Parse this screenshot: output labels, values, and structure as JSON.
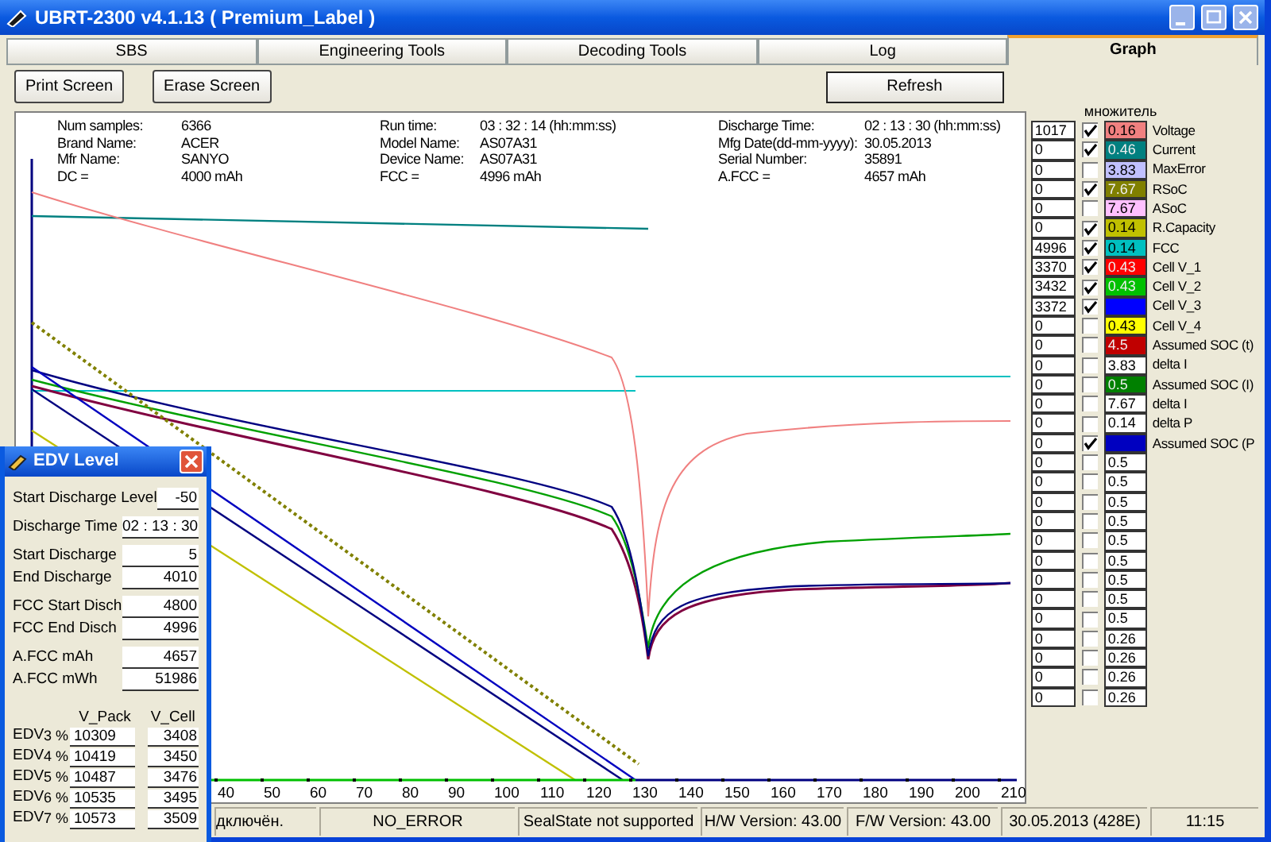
{
  "window": {
    "title": "UBRT-2300 v4.1.13  ( Premium_Label )"
  },
  "tabs": [
    {
      "label": "SBS",
      "selected": false
    },
    {
      "label": "Engineering Tools",
      "selected": false
    },
    {
      "label": "Decoding Tools",
      "selected": false
    },
    {
      "label": "Log",
      "selected": false
    },
    {
      "label": "Graph",
      "selected": true
    }
  ],
  "toolbar": {
    "buttons": [
      {
        "label": "Print Screen"
      },
      {
        "label": "Erase Screen"
      }
    ],
    "refresh_button": {
      "label": "Refresh"
    }
  },
  "info_columns": [
    [
      {
        "label": "Num samples:",
        "value": "6366"
      },
      {
        "label": "Brand Name:",
        "value": "ACER"
      },
      {
        "label": "Mfr Name:",
        "value": "SANYO"
      },
      {
        "label": "DC =",
        "value": "4000 mAh"
      }
    ],
    [
      {
        "label": "Run time:",
        "value": "03 : 32 : 14 (hh:mm:ss)"
      },
      {
        "label": "Model Name:",
        "value": "AS07A31"
      },
      {
        "label": "Device Name:",
        "value": "AS07A31"
      },
      {
        "label": "FCC =",
        "value": "4996 mAh"
      }
    ],
    [
      {
        "label": "Discharge Time:",
        "value": "02 : 13 : 30 (hh:mm:ss)"
      },
      {
        "label": "Mfg Date(dd-mm-yyyy):",
        "value": "30.05.2013"
      },
      {
        "label": "Serial Number:",
        "value": "35891"
      },
      {
        "label": "A.FCC =",
        "value": "4657 mAh"
      }
    ]
  ],
  "chart": {
    "x_axis_labels": [
      "40",
      "50",
      "60",
      "70",
      "80",
      "90",
      "100",
      "110",
      "120",
      "130",
      "140",
      "150",
      "160",
      "170",
      "180",
      "190",
      "200",
      "210"
    ]
  },
  "channel_panel": {
    "header": "множитель",
    "channels": [
      {
        "value": "1017",
        "checked": true,
        "multiplier": "0.16",
        "color": "#f08080",
        "label": "Voltage"
      },
      {
        "value": "0",
        "checked": true,
        "multiplier": "0.46",
        "color": "#008080",
        "label": "Current"
      },
      {
        "value": "0",
        "checked": false,
        "multiplier": "3.83",
        "color": "#c0c0ff",
        "label": "MaxError"
      },
      {
        "value": "0",
        "checked": true,
        "multiplier": "7.67",
        "color": "#808000",
        "label": "RSoC"
      },
      {
        "value": "0",
        "checked": false,
        "multiplier": "7.67",
        "color": "#ffc0ff",
        "label": "ASoC"
      },
      {
        "value": "0",
        "checked": true,
        "multiplier": "0.14",
        "color": "#c0c000",
        "label": "R.Capacity"
      },
      {
        "value": "4996",
        "checked": true,
        "multiplier": "0.14",
        "color": "#00c0c0",
        "label": "FCC"
      },
      {
        "value": "3370",
        "checked": true,
        "multiplier": "0.43",
        "color": "#ff0000",
        "label": "Cell V_1"
      },
      {
        "value": "3432",
        "checked": true,
        "multiplier": "0.43",
        "color": "#00c000",
        "label": "Cell V_2"
      },
      {
        "value": "3372",
        "checked": true,
        "color": "#0000ff",
        "label": "Cell V_3"
      },
      {
        "value": "0",
        "checked": false,
        "multiplier": "0.43",
        "color": "#ffff00",
        "label": "Cell V_4"
      },
      {
        "value": "0",
        "checked": false,
        "multiplier": "4.5",
        "color": "#c00000",
        "label": "Assumed SOC (t)"
      },
      {
        "value": "0",
        "checked": false,
        "multiplier": "3.83",
        "color": "#ffffff",
        "label": "delta I"
      },
      {
        "value": "0",
        "checked": false,
        "multiplier": "0.5",
        "color": "#008000",
        "label": "Assumed SOC (I)"
      },
      {
        "value": "0",
        "checked": false,
        "multiplier": "7.67",
        "color": "#ffffff",
        "label": "delta I"
      },
      {
        "value": "0",
        "checked": false,
        "multiplier": "0.14",
        "color": "#ffffff",
        "label": "delta P"
      },
      {
        "value": "0",
        "checked": true,
        "color": "#0000c0",
        "label": "Assumed SOC (P"
      },
      {
        "value": "0",
        "checked": false,
        "multiplier": "0.5",
        "color": "#ffffff"
      },
      {
        "value": "0",
        "checked": false,
        "multiplier": "0.5",
        "color": "#ffffff"
      },
      {
        "value": "0",
        "checked": false,
        "multiplier": "0.5",
        "color": "#ffffff"
      },
      {
        "value": "0",
        "checked": false,
        "multiplier": "0.5",
        "color": "#ffffff"
      },
      {
        "value": "0",
        "checked": false,
        "multiplier": "0.5",
        "color": "#ffffff"
      },
      {
        "value": "0",
        "checked": false,
        "multiplier": "0.5",
        "color": "#ffffff"
      },
      {
        "value": "0",
        "checked": false,
        "multiplier": "0.5",
        "color": "#ffffff"
      },
      {
        "value": "0",
        "checked": false,
        "multiplier": "0.5",
        "color": "#ffffff"
      },
      {
        "value": "0",
        "checked": false,
        "multiplier": "0.5",
        "color": "#ffffff"
      },
      {
        "value": "0",
        "checked": false,
        "multiplier": "0.26",
        "color": "#ffffff"
      },
      {
        "value": "0",
        "checked": false,
        "multiplier": "0.26",
        "color": "#ffffff"
      },
      {
        "value": "0",
        "checked": false,
        "multiplier": "0.26",
        "color": "#ffffff"
      },
      {
        "value": "0",
        "checked": false,
        "multiplier": "0.26",
        "color": "#ffffff"
      }
    ]
  },
  "status_bar": [
    "дключён.",
    "NO_ERROR",
    "SealState not supported",
    "H/W Version: 43.00",
    "F/W Version: 43.00",
    "30.05.2013  (428E)",
    "11:15"
  ],
  "edv_dialog": {
    "title": "EDV Level",
    "field_groups": [
      [
        {
          "label": "Start Discharge Level",
          "value": "-50"
        }
      ],
      [
        {
          "label": "Discharge Time",
          "value": "02 : 13 : 30"
        }
      ],
      [
        {
          "label": "Start Discharge",
          "value": "5"
        },
        {
          "label": "End  Discharge",
          "value": "4010"
        }
      ],
      [
        {
          "label": "FCC Start Disch",
          "value": "4800"
        },
        {
          "label": "FCC End  Disch",
          "value": "4996"
        }
      ],
      [
        {
          "label": "A.FCC mAh",
          "value": "4657"
        },
        {
          "label": "A.FCC mWh",
          "value": "51986"
        }
      ]
    ],
    "table": {
      "columns": [
        "V_Pack",
        "V_Cell"
      ],
      "rows": [
        {
          "label": "EDV",
          "percent": "3 %",
          "v_pack": "10309",
          "v_cell": "3408"
        },
        {
          "label": "EDV",
          "percent": "4 %",
          "v_pack": "10419",
          "v_cell": "3450"
        },
        {
          "label": "EDV",
          "percent": "5 %",
          "v_pack": "10487",
          "v_cell": "3476"
        },
        {
          "label": "EDV",
          "percent": "6 %",
          "v_pack": "10535",
          "v_cell": "3495"
        },
        {
          "label": "EDV",
          "percent": "7 %",
          "v_pack": "10573",
          "v_cell": "3509"
        }
      ]
    }
  }
}
